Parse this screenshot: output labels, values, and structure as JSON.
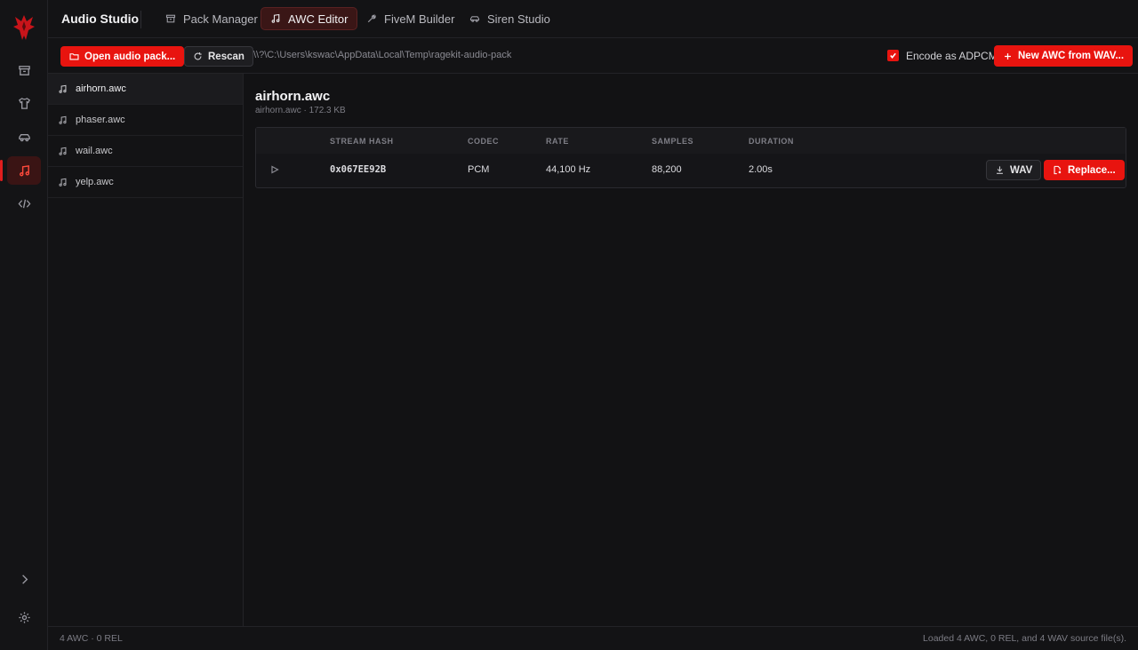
{
  "app": {
    "title": "Audio Studio"
  },
  "nav": {
    "tabs": [
      {
        "label": "Pack Manager",
        "icon": "package-icon",
        "active": false
      },
      {
        "label": "AWC Editor",
        "icon": "music-note-icon",
        "active": true
      },
      {
        "label": "FiveM Builder",
        "icon": "wrench-icon",
        "active": false
      },
      {
        "label": "Siren Studio",
        "icon": "car-icon",
        "active": false
      }
    ]
  },
  "rail": {
    "items": [
      "package-icon",
      "shirt-icon",
      "car-icon",
      "music-note-icon",
      "code-icon"
    ],
    "active": "music-note-icon",
    "bottom": [
      "chevron-right-icon",
      "gear-icon"
    ]
  },
  "toolbar": {
    "open_label": "Open audio pack...",
    "rescan_label": "Rescan",
    "path": "\\\\?\\C:\\Users\\kswac\\AppData\\Local\\Temp\\ragekit-audio-pack",
    "encode_label": "Encode as ADPCM",
    "encode_checked": true,
    "new_awc_label": "New AWC from WAV..."
  },
  "files": [
    {
      "name": "airhorn.awc",
      "active": true
    },
    {
      "name": "phaser.awc",
      "active": false
    },
    {
      "name": "wail.awc",
      "active": false
    },
    {
      "name": "yelp.awc",
      "active": false
    }
  ],
  "detail": {
    "title": "airhorn.awc",
    "subtitle": "airhorn.awc · 172.3 KB",
    "columns": [
      "STREAM HASH",
      "CODEC",
      "RATE",
      "SAMPLES",
      "DURATION"
    ],
    "rows": [
      {
        "hash": "0x067EE92B",
        "codec": "PCM",
        "rate": "44,100 Hz",
        "samples": "88,200",
        "duration": "2.00s",
        "wav_label": "WAV",
        "replace_label": "Replace..."
      }
    ]
  },
  "status": {
    "left": "4 AWC · 0 REL",
    "right": "Loaded 4 AWC, 0 REL, and 4 WAV source file(s)."
  },
  "colors": {
    "accent": "#e8140f",
    "background": "#121214",
    "active_tab": "#3a1616"
  }
}
